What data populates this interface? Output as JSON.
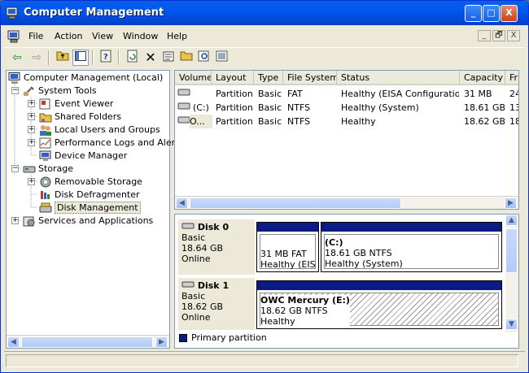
{
  "window": {
    "title": "Computer Management",
    "controls": {
      "minimize": "_",
      "maximize": "□",
      "close": "X"
    }
  },
  "menu": [
    "File",
    "Action",
    "View",
    "Window",
    "Help"
  ],
  "mdi_controls": [
    "_",
    "🗗",
    "X"
  ],
  "toolbar": [
    "back-arrow-icon",
    "forward-arrow-icon",
    "up-folder-icon",
    "show-tree-icon",
    "help-icon",
    "refresh-icon",
    "delete-icon",
    "properties-icon",
    "open-icon",
    "search-icon",
    "export-icon"
  ],
  "tree": {
    "root": "Computer Management (Local)",
    "system_tools": "System Tools",
    "event_viewer": "Event Viewer",
    "shared_folders": "Shared Folders",
    "local_users": "Local Users and Groups",
    "perf_logs": "Performance Logs and Alerts",
    "device_manager": "Device Manager",
    "storage": "Storage",
    "removable": "Removable Storage",
    "defrag": "Disk Defragmenter",
    "disk_mgmt": "Disk Management",
    "services": "Services and Applications"
  },
  "columns": [
    "Volume",
    "Layout",
    "Type",
    "File System",
    "Status",
    "Capacity",
    "Fr"
  ],
  "volumes": [
    {
      "volume": "",
      "layout": "Partition",
      "type": "Basic",
      "fs": "FAT",
      "status": "Healthy (EISA Configuration)",
      "capacity": "31 MB",
      "free": "24"
    },
    {
      "volume": "(C:)",
      "layout": "Partition",
      "type": "Basic",
      "fs": "NTFS",
      "status": "Healthy (System)",
      "capacity": "18.61 GB",
      "free": "13"
    },
    {
      "volume": "O...",
      "layout": "Partition",
      "type": "Basic",
      "fs": "NTFS",
      "status": "Healthy",
      "capacity": "18.62 GB",
      "free": "18"
    }
  ],
  "disks": [
    {
      "name": "Disk 0",
      "type": "Basic",
      "size": "18.64 GB",
      "state": "Online",
      "p1": {
        "line1": "31 MB FAT",
        "line2": "Healthy (EIS/"
      },
      "p2": {
        "name": "(C:)",
        "line1": "18.61 GB NTFS",
        "line2": "Healthy (System)"
      }
    },
    {
      "name": "Disk 1",
      "type": "Basic",
      "size": "18.62 GB",
      "state": "Online",
      "p1": {
        "name": "OWC Mercury  (E:)",
        "line1": "18.62 GB NTFS",
        "line2": "Healthy"
      }
    }
  ],
  "legend": "Primary partition",
  "colors": {
    "primary_partition": "#0a1c83",
    "titlebar": "#0058ee"
  }
}
